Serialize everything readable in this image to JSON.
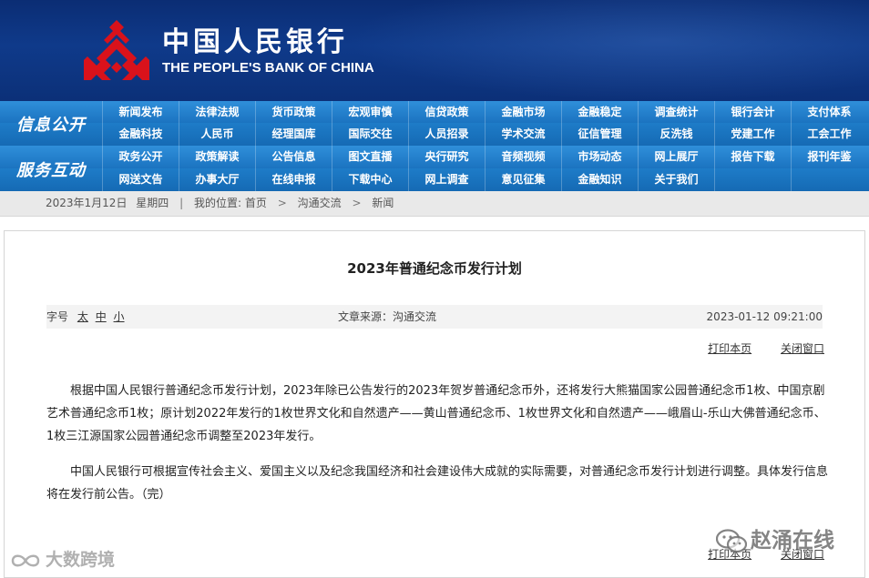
{
  "header": {
    "brand_cn": "中国人民银行",
    "brand_en": "THE PEOPLE'S BANK OF CHINA",
    "logo_icon": "pboc-logo-icon",
    "bg_color": "#0f3a8a",
    "logo_color": "#d9121b"
  },
  "nav": {
    "sections": [
      "信息公开",
      "服务互动"
    ],
    "rows": [
      [
        "新闻发布",
        "法律法规",
        "货币政策",
        "宏观审慎",
        "信贷政策",
        "金融市场",
        "金融稳定",
        "调查统计",
        "银行会计",
        "支付体系"
      ],
      [
        "金融科技",
        "人民币",
        "经理国库",
        "国际交往",
        "人员招录",
        "学术交流",
        "征信管理",
        "反洗钱",
        "党建工作",
        "工会工作"
      ],
      [
        "政务公开",
        "政策解读",
        "公告信息",
        "图文直播",
        "央行研究",
        "音频视频",
        "市场动态",
        "网上展厅",
        "报告下载",
        "报刊年鉴"
      ],
      [
        "网送文告",
        "办事大厅",
        "在线申报",
        "下载中心",
        "网上调查",
        "意见征集",
        "金融知识",
        "关于我们",
        "",
        ""
      ]
    ]
  },
  "breadcrumb": {
    "date": "2023年1月12日",
    "weekday": "星期四",
    "location_label": "我的位置",
    "items": [
      "首页",
      "沟通交流",
      "新闻"
    ]
  },
  "article": {
    "title": "2023年普通纪念币发行计划",
    "font_size_label": "字号",
    "font_sizes": [
      "太",
      "中",
      "小"
    ],
    "source": "文章来源：沟通交流",
    "datetime": "2023-01-12 09:21:00",
    "print_label": "打印本页",
    "close_label": "关闭窗口",
    "paragraphs": [
      "根据中国人民银行普通纪念币发行计划，2023年除已公告发行的2023年贺岁普通纪念币外，还将发行大熊猫国家公园普通纪念币1枚、中国京剧艺术普通纪念币1枚；原计划2022年发行的1枚世界文化和自然遗产——黄山普通纪念币、1枚世界文化和自然遗产——峨眉山-乐山大佛普通纪念币、1枚三江源国家公园普通纪念币调整至2023年发行。",
      "中国人民银行可根据宣传社会主义、爱国主义以及纪念我国经济和社会建设伟大成就的实际需要，对普通纪念币发行计划进行调整。具体发行信息将在发行前公告。（完）"
    ]
  },
  "watermarks": {
    "left": "大数跨境",
    "right": "赵涌在线"
  }
}
